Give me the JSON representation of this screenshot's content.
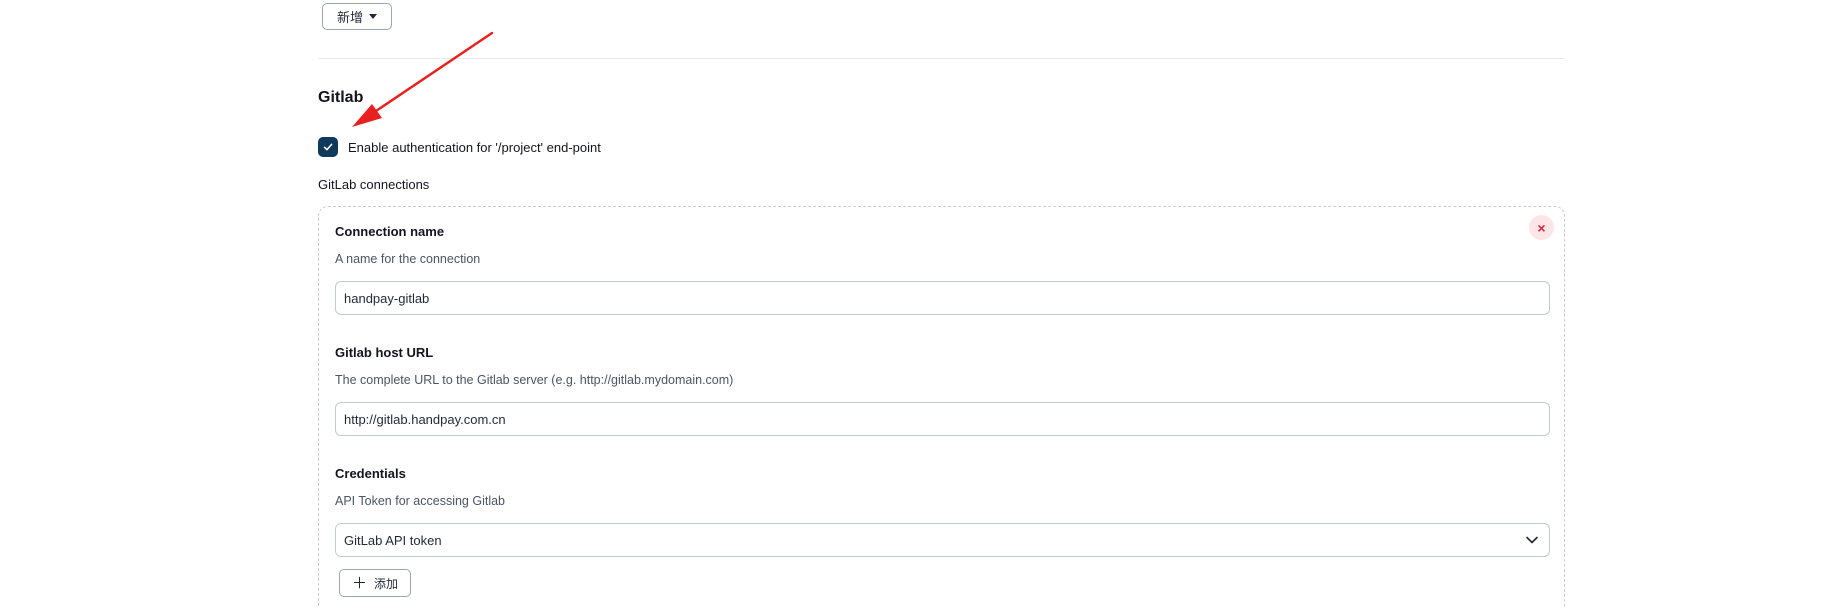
{
  "top": {
    "add_button_label": "新增"
  },
  "section": {
    "title": "Gitlab",
    "checkbox_label": "Enable authentication for '/project' end-point",
    "checkbox_checked": true,
    "connections_label": "GitLab connections"
  },
  "connection": {
    "delete_symbol": "×",
    "name_label": "Connection name",
    "name_desc": "A name for the connection",
    "name_value": "handpay-gitlab",
    "url_label": "Gitlab host URL",
    "url_desc": "The complete URL to the Gitlab server (e.g. http://gitlab.mydomain.com)",
    "url_value": "http://gitlab.handpay.com.cn",
    "cred_label": "Credentials",
    "cred_desc": "API Token for accessing Gitlab",
    "cred_value": "GitLab API token",
    "add_cred_label": "添加"
  },
  "annotation": {
    "arrow_color": "#e8201f"
  }
}
